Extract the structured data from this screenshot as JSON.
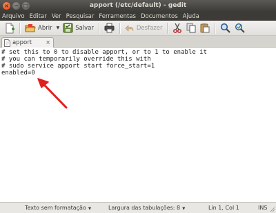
{
  "window": {
    "title": "apport (/etc/default) - gedit",
    "close_glyph": "×",
    "minimize_glyph": "−",
    "maximize_glyph": "□"
  },
  "menubar": {
    "items": [
      "Arquivo",
      "Editar",
      "Ver",
      "Pesquisar",
      "Ferramentas",
      "Documentos",
      "Ajuda"
    ]
  },
  "toolbar": {
    "new_icon": "new-document-icon",
    "open_label": "Abrir",
    "save_label": "Salvar",
    "print_icon": "print-icon",
    "undo_label": "Desfazer",
    "undo_enabled": false,
    "cut_icon": "scissors-icon",
    "copy_icon": "copy-icon",
    "paste_icon": "paste-icon",
    "find_icon": "search-icon",
    "replace_icon": "replace-icon"
  },
  "tabs": [
    {
      "label": "apport",
      "close_glyph": "×",
      "active": true
    }
  ],
  "editor": {
    "lines": [
      "# set this to 0 to disable apport, or to 1 to enable it",
      "# you can temporarily override this with",
      "# sudo service apport start force_start=1",
      "enabled=0"
    ],
    "annotation_color": "#e0201c"
  },
  "statusbar": {
    "syntax": "Texto sem formatação",
    "tab_width_label": "Largura das tabulações:  8",
    "cursor_position": "Lin 1, Col 1",
    "insert_mode": "INS",
    "dropdown_glyph": "▼"
  },
  "colors": {
    "titlebar": "#3c3b37",
    "title_text": "#dfdbd2",
    "close_button": "#df4a16",
    "editor_bg": "#ffffff"
  }
}
